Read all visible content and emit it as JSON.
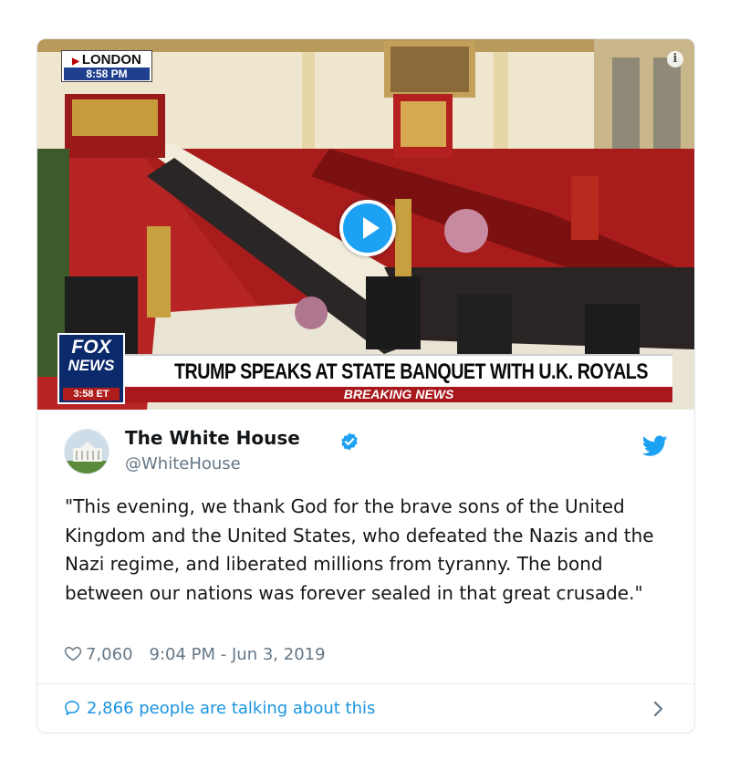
{
  "video": {
    "location": "LONDON",
    "local_time": "8:58 PM",
    "network_logo_top": "FOX",
    "network_logo_bottom": "NEWS",
    "network_time": "3:58 ET",
    "headline": "TRUMP SPEAKS AT STATE BANQUET WITH U.K. ROYALS",
    "ticker": "BREAKING NEWS",
    "info_icon": "i"
  },
  "tweet": {
    "display_name": "The White House",
    "handle": "@WhiteHouse",
    "text": "\"This evening, we thank God for the brave sons of the United Kingdom and the United States, who defeated the Nazis and the Nazi regime, and liberated millions from tyranny. The bond between our nations was forever sealed in that great crusade.\"",
    "likes": "7,060",
    "timestamp": "9:04 PM - Jun 3, 2019",
    "talking": "2,866 people are talking about this"
  },
  "icons": {
    "verified": "verified-badge-icon",
    "brand": "twitter-bird-icon",
    "like": "heart-icon",
    "reply": "speech-bubble-icon",
    "more": "chevron-right-icon",
    "play": "play-icon"
  },
  "colors": {
    "accent": "#1da1f2",
    "link": "#1b95e0",
    "muted": "#657786",
    "text": "#14171a",
    "fox_blue": "#0b2a6b",
    "breaking_red": "#a8181c"
  }
}
